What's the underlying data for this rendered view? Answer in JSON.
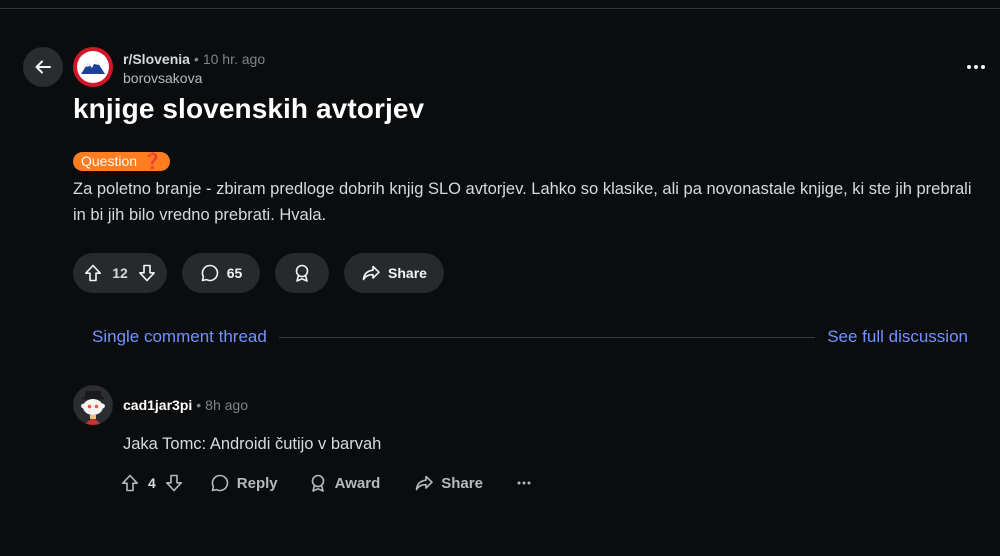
{
  "post": {
    "subreddit": "r/Slovenia",
    "time": "10 hr. ago",
    "author": "borovsakova",
    "title": "knjige slovenskih avtorjev",
    "flair": "Question",
    "flair_emoji": "❓",
    "body": "Za poletno branje - zbiram predloge dobrih knjig SLO avtorjev. Lahko so klasike, ali pa novonastale knjige, ki ste jih prebrali in bi jih bilo vredno prebrati. Hvala.",
    "votes": "12",
    "comments": "65",
    "share_label": "Share"
  },
  "thread": {
    "single_label": "Single comment thread",
    "full_label": "See full discussion"
  },
  "comment": {
    "author": "cad1jar3pi",
    "time": "8h ago",
    "body": "Jaka Tomc: Androidi čutijo v barvah",
    "votes": "4",
    "reply_label": "Reply",
    "award_label": "Award",
    "share_label": "Share"
  },
  "colors": {
    "background": "#0b0c0e",
    "pill": "#272a2d",
    "link": "#7193ff",
    "flair": "#ff7c1f"
  }
}
